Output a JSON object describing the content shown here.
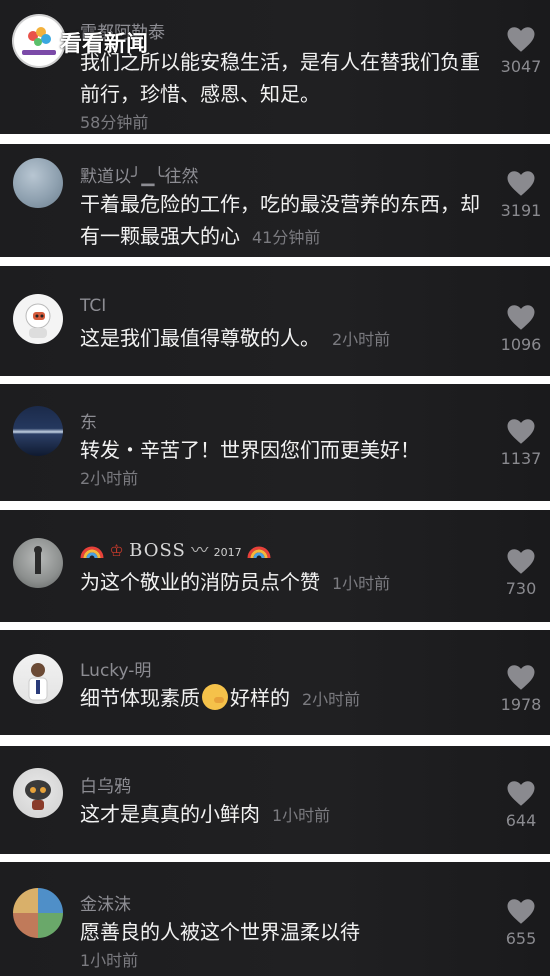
{
  "overlay": {
    "brand_name": "看看新闻"
  },
  "comments": [
    {
      "username": "雷都阿勒泰",
      "text": "我们之所以能安稳生活，是有人在替我们负重前行，珍惜、感恩、知足。",
      "time": "58分钟前",
      "likes": "3047"
    },
    {
      "username": "默道以╯▁╰往然",
      "text": "干着最危险的工作，吃的最没营养的东西，却有一颗最强大的心",
      "time": "41分钟前",
      "likes": "3191"
    },
    {
      "username": "TCI",
      "text": "这是我们最值得尊敬的人。",
      "time": "2小时前",
      "likes": "1096"
    },
    {
      "username": "东",
      "text": "转发・辛苦了！世界因您们而更美好！",
      "time": "2小时前",
      "likes": "1137"
    },
    {
      "username": "BOSS",
      "username_year": "2017",
      "text": "为这个敬业的消防员点个赞",
      "time": "1小时前",
      "likes": "730"
    },
    {
      "username": "Lucky-明",
      "text_before": "细节体现素质",
      "text_after": "好样的",
      "time": "2小时前",
      "likes": "1978"
    },
    {
      "username": "白乌鸦",
      "text": "这才是真真的小鲜肉",
      "time": "1小时前",
      "likes": "644"
    },
    {
      "username": "金沫沫",
      "text": "愿善良的人被这个世界温柔以待",
      "time": "1小时前",
      "likes": "655"
    }
  ],
  "icons": {
    "like": "heart-icon",
    "emoji": "thinking-face-emoji",
    "rainbow": "rainbow-emoji"
  },
  "colors": {
    "card_bg": "#1e1e20",
    "page_bg": "#ffffff",
    "username": "#8d8d93",
    "text": "#f2f2f2",
    "meta": "#7b7b80"
  }
}
